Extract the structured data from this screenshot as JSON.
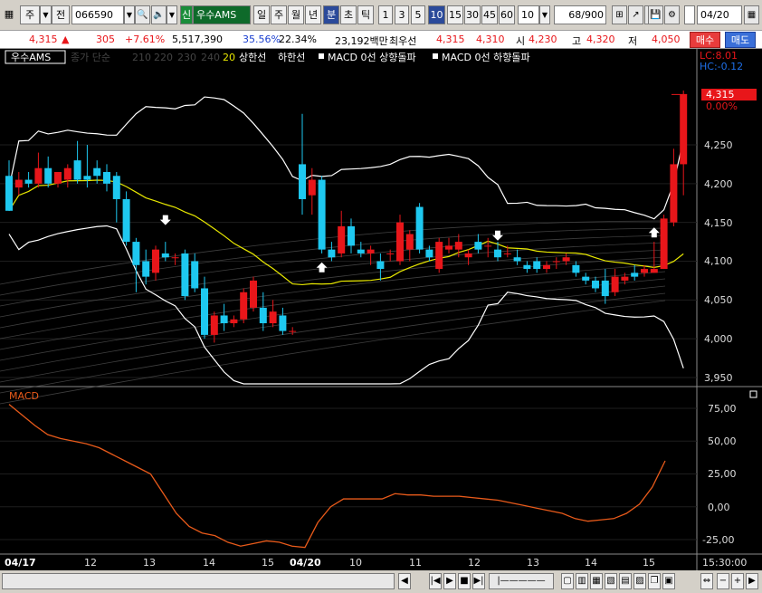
{
  "toolbar": {
    "mode": "주",
    "jeon": "전",
    "code": "066590",
    "badge": "신",
    "name": "우수AMS",
    "periods": [
      "일",
      "주",
      "월",
      "년",
      "분",
      "초",
      "틱"
    ],
    "active_period": "분",
    "intervals": [
      "1",
      "3",
      "5",
      "10",
      "15",
      "30",
      "45",
      "60"
    ],
    "active_interval": "10",
    "interval_select": "10",
    "count": "68",
    "count_total": "/900",
    "date": "04/20"
  },
  "quote": {
    "price": "4,315",
    "arrow": "▲",
    "change": "305",
    "change_pct": "+7.61%",
    "volume": "5,517,390",
    "ratio1": "35.56%",
    "ratio2": "22.34%",
    "amount": "23,192백만",
    "label_best": "최우선",
    "best_ask": "4,315",
    "best_bid": "4,310",
    "label_open": "시",
    "open": "4,230",
    "label_high": "고",
    "high": "4,320",
    "label_low": "저",
    "low": "4,050",
    "buy_label": "매수",
    "sell_label": "매도"
  },
  "legend": {
    "name": "우수AMS",
    "items": [
      "종가 단순",
      "210",
      "220",
      "230",
      "240",
      "20",
      "상한선",
      "하한선",
      "MACD 0선 상향돌파",
      "MACD 0선 하향돌파"
    ],
    "lc": "LC:8.01",
    "hc": "HC:-0.12"
  },
  "price_axis": {
    "ticks": [
      "4,250",
      "4,200",
      "4,150",
      "4,100",
      "4,050",
      "4,000",
      "3,950"
    ],
    "current_price": "4,315",
    "current_pct": "0.00%"
  },
  "macd": {
    "label": "MACD",
    "ticks": [
      "75,00",
      "50,00",
      "25,00",
      "0,00",
      "-25,00"
    ]
  },
  "time_axis": {
    "labels": [
      "04/17",
      "12",
      "13",
      "14",
      "15",
      "04/20",
      "10",
      "11",
      "12",
      "13",
      "14",
      "15"
    ],
    "bold": [
      "04/17",
      "04/20"
    ],
    "end_time": "15:30:00"
  },
  "colors": {
    "up": "#e8161a",
    "down": "#1ec8f0",
    "band": "#ffffff",
    "ma20": "#e8e800",
    "macd": "#e85a1a",
    "grid": "#3a3a3a"
  },
  "chart_data": {
    "type": "candlestick",
    "ylim": [
      3940,
      4320
    ],
    "candles": [
      {
        "o": 4210,
        "h": 4230,
        "l": 4165,
        "c": 4165
      },
      {
        "o": 4195,
        "h": 4215,
        "l": 4185,
        "c": 4205
      },
      {
        "o": 4205,
        "h": 4215,
        "l": 4195,
        "c": 4200
      },
      {
        "o": 4200,
        "h": 4240,
        "l": 4195,
        "c": 4220
      },
      {
        "o": 4220,
        "h": 4235,
        "l": 4195,
        "c": 4200
      },
      {
        "o": 4200,
        "h": 4215,
        "l": 4195,
        "c": 4215
      },
      {
        "o": 4205,
        "h": 4225,
        "l": 4195,
        "c": 4220
      },
      {
        "o": 4230,
        "h": 4255,
        "l": 4200,
        "c": 4205
      },
      {
        "o": 4210,
        "h": 4250,
        "l": 4195,
        "c": 4205
      },
      {
        "o": 4220,
        "h": 4230,
        "l": 4200,
        "c": 4210
      },
      {
        "o": 4215,
        "h": 4225,
        "l": 4190,
        "c": 4200
      },
      {
        "o": 4210,
        "h": 4215,
        "l": 4150,
        "c": 4180
      },
      {
        "o": 4180,
        "h": 4190,
        "l": 4120,
        "c": 4125
      },
      {
        "o": 4125,
        "h": 4130,
        "l": 4060,
        "c": 4095
      },
      {
        "o": 4100,
        "h": 4115,
        "l": 4070,
        "c": 4080
      },
      {
        "o": 4085,
        "h": 4120,
        "l": 4075,
        "c": 4115
      },
      {
        "o": 4110,
        "h": 4125,
        "l": 4100,
        "c": 4105
      },
      {
        "o": 4105,
        "h": 4110,
        "l": 4095,
        "c": 4105
      },
      {
        "o": 4110,
        "h": 4115,
        "l": 4050,
        "c": 4055
      },
      {
        "o": 4100,
        "h": 4110,
        "l": 4060,
        "c": 4065
      },
      {
        "o": 4065,
        "h": 4080,
        "l": 4000,
        "c": 4005
      },
      {
        "o": 4005,
        "h": 4035,
        "l": 3995,
        "c": 4030
      },
      {
        "o": 4030,
        "h": 4045,
        "l": 4010,
        "c": 4020
      },
      {
        "o": 4020,
        "h": 4030,
        "l": 4015,
        "c": 4025
      },
      {
        "o": 4025,
        "h": 4065,
        "l": 4020,
        "c": 4060
      },
      {
        "o": 4040,
        "h": 4080,
        "l": 4035,
        "c": 4075
      },
      {
        "o": 4040,
        "h": 4060,
        "l": 4010,
        "c": 4020
      },
      {
        "o": 4020,
        "h": 4050,
        "l": 4015,
        "c": 4035
      },
      {
        "o": 4030,
        "h": 4040,
        "l": 4005,
        "c": 4010
      },
      {
        "o": 4010,
        "h": 4015,
        "l": 4005,
        "c": 4010
      },
      {
        "o": 4225,
        "h": 4290,
        "l": 4160,
        "c": 4180
      },
      {
        "o": 4185,
        "h": 4220,
        "l": 4160,
        "c": 4205
      },
      {
        "o": 4205,
        "h": 4210,
        "l": 4110,
        "c": 4115
      },
      {
        "o": 4115,
        "h": 4125,
        "l": 4100,
        "c": 4105
      },
      {
        "o": 4110,
        "h": 4165,
        "l": 4105,
        "c": 4145
      },
      {
        "o": 4145,
        "h": 4155,
        "l": 4110,
        "c": 4120
      },
      {
        "o": 4115,
        "h": 4125,
        "l": 4105,
        "c": 4110
      },
      {
        "o": 4110,
        "h": 4120,
        "l": 4095,
        "c": 4115
      },
      {
        "o": 4100,
        "h": 4110,
        "l": 4075,
        "c": 4090
      },
      {
        "o": 4110,
        "h": 4115,
        "l": 4100,
        "c": 4110
      },
      {
        "o": 4100,
        "h": 4160,
        "l": 4095,
        "c": 4150
      },
      {
        "o": 4115,
        "h": 4140,
        "l": 4100,
        "c": 4135
      },
      {
        "o": 4170,
        "h": 4175,
        "l": 4110,
        "c": 4115
      },
      {
        "o": 4115,
        "h": 4120,
        "l": 4100,
        "c": 4105
      },
      {
        "o": 4090,
        "h": 4130,
        "l": 4085,
        "c": 4125
      },
      {
        "o": 4115,
        "h": 4130,
        "l": 4110,
        "c": 4120
      },
      {
        "o": 4115,
        "h": 4135,
        "l": 4105,
        "c": 4125
      },
      {
        "o": 4105,
        "h": 4115,
        "l": 4095,
        "c": 4110
      },
      {
        "o": 4125,
        "h": 4135,
        "l": 4110,
        "c": 4115
      },
      {
        "o": 4120,
        "h": 4130,
        "l": 4105,
        "c": 4120
      },
      {
        "o": 4115,
        "h": 4125,
        "l": 4100,
        "c": 4105
      },
      {
        "o": 4110,
        "h": 4120,
        "l": 4105,
        "c": 4110
      },
      {
        "o": 4105,
        "h": 4115,
        "l": 4095,
        "c": 4100
      },
      {
        "o": 4095,
        "h": 4100,
        "l": 4085,
        "c": 4090
      },
      {
        "o": 4100,
        "h": 4105,
        "l": 4085,
        "c": 4090
      },
      {
        "o": 4090,
        "h": 4100,
        "l": 4085,
        "c": 4095
      },
      {
        "o": 4100,
        "h": 4105,
        "l": 4090,
        "c": 4100
      },
      {
        "o": 4100,
        "h": 4110,
        "l": 4095,
        "c": 4105
      },
      {
        "o": 4095,
        "h": 4100,
        "l": 4080,
        "c": 4085
      },
      {
        "o": 4080,
        "h": 4085,
        "l": 4070,
        "c": 4075
      },
      {
        "o": 4075,
        "h": 4080,
        "l": 4060,
        "c": 4065
      },
      {
        "o": 4075,
        "h": 4090,
        "l": 4045,
        "c": 4055
      },
      {
        "o": 4060,
        "h": 4090,
        "l": 4055,
        "c": 4080
      },
      {
        "o": 4075,
        "h": 4085,
        "l": 4070,
        "c": 4080
      },
      {
        "o": 4085,
        "h": 4095,
        "l": 4075,
        "c": 4080
      },
      {
        "o": 4085,
        "h": 4095,
        "l": 4080,
        "c": 4090
      },
      {
        "o": 4085,
        "h": 4125,
        "l": 4085,
        "c": 4090
      },
      {
        "o": 4090,
        "h": 4160,
        "l": 4090,
        "c": 4155
      },
      {
        "o": 4150,
        "h": 4245,
        "l": 4145,
        "c": 4225
      },
      {
        "o": 4225,
        "h": 4320,
        "l": 4185,
        "c": 4315
      }
    ],
    "macd": [
      78,
      70,
      62,
      55,
      52,
      50,
      48,
      45,
      40,
      35,
      30,
      25,
      10,
      -5,
      -15,
      -20,
      -22,
      -27,
      -30,
      -28,
      -26,
      -27,
      -30,
      -31,
      -12,
      0,
      6,
      6,
      6,
      6,
      10,
      9,
      9,
      8,
      8,
      8,
      7,
      6,
      5,
      3,
      1,
      -1,
      -3,
      -5,
      -9,
      -11,
      -10,
      -9,
      -5,
      2,
      15,
      35
    ]
  }
}
